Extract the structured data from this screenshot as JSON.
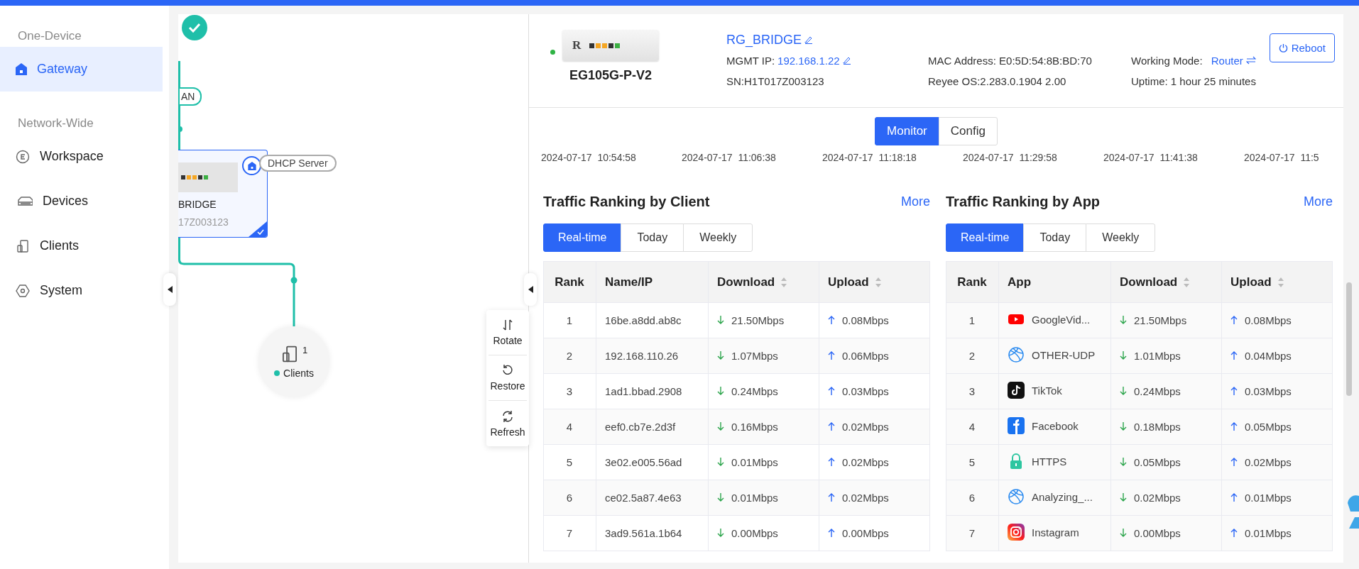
{
  "sidebar": {
    "sections": [
      {
        "title": "One-Device",
        "items": [
          {
            "label": "Gateway",
            "kind": "home",
            "selected": true
          }
        ]
      },
      {
        "title": "Network-Wide",
        "items": [
          {
            "label": "Workspace",
            "kind": "workspace",
            "selected": false
          },
          {
            "label": "Devices",
            "kind": "devices",
            "selected": false
          },
          {
            "label": "Clients",
            "kind": "clients",
            "selected": false
          },
          {
            "label": "System",
            "kind": "system",
            "selected": false
          }
        ]
      }
    ]
  },
  "topology": {
    "wan_label": "AN",
    "device": {
      "name": "BRIDGE",
      "serial": "17Z003123",
      "role": "DHCP Server",
      "selected": true
    },
    "clients": {
      "count": "1",
      "label": "Clients"
    },
    "tools": [
      {
        "label": "Rotate",
        "kind": "rotate"
      },
      {
        "label": "Restore",
        "kind": "restore"
      },
      {
        "label": "Refresh",
        "kind": "refresh"
      }
    ]
  },
  "device": {
    "online": true,
    "logo_letter": "R",
    "model": "EG105G-P-V2",
    "name": "RG_BRIDGE",
    "mgmt_ip_label": "MGMT IP:",
    "mgmt_ip": "192.168.1.22",
    "sn": "SN:H1T017Z003123",
    "mac": "MAC Address: E0:5D:54:8B:BD:70",
    "os": "Reyee OS:2.283.0.1904 2.00",
    "mode_label": "Working Mode:",
    "mode": "Router",
    "uptime": "Uptime: 1 hour 25 minutes",
    "reboot": "Reboot"
  },
  "view_tabs": [
    {
      "label": "Monitor",
      "selected": true
    },
    {
      "label": "Config",
      "selected": false
    }
  ],
  "timeline_labels": [
    "2024-07-17  10:54:58",
    "2024-07-17  11:06:38",
    "2024-07-17  11:18:18",
    "2024-07-17  11:29:58",
    "2024-07-17  11:41:38",
    "2024-07-17  11:5"
  ],
  "panels": [
    {
      "title": "Traffic Ranking by Client",
      "more": "More",
      "periods": [
        {
          "label": "Real-time",
          "selected": true
        },
        {
          "label": "Today",
          "selected": false
        },
        {
          "label": "Weekly",
          "selected": false
        }
      ],
      "columns": [
        "Rank",
        "Name/IP",
        "Download",
        "Upload"
      ],
      "rows": [
        {
          "rank": "1",
          "name": "16be.a8dd.ab8c",
          "download": "21.50Mbps",
          "upload": "0.08Mbps"
        },
        {
          "rank": "2",
          "name": "192.168.110.26",
          "download": "1.07Mbps",
          "upload": "0.06Mbps"
        },
        {
          "rank": "3",
          "name": "1ad1.bbad.2908",
          "download": "0.24Mbps",
          "upload": "0.03Mbps"
        },
        {
          "rank": "4",
          "name": "eef0.cb7e.2d3f",
          "download": "0.16Mbps",
          "upload": "0.02Mbps"
        },
        {
          "rank": "5",
          "name": "3e02.e005.56ad",
          "download": "0.01Mbps",
          "upload": "0.02Mbps"
        },
        {
          "rank": "6",
          "name": "ce02.5a87.4e63",
          "download": "0.01Mbps",
          "upload": "0.02Mbps"
        },
        {
          "rank": "7",
          "name": "3ad9.561a.1b64",
          "download": "0.00Mbps",
          "upload": "0.00Mbps"
        }
      ]
    },
    {
      "title": "Traffic Ranking by App",
      "more": "More",
      "periods": [
        {
          "label": "Real-time",
          "selected": true
        },
        {
          "label": "Today",
          "selected": false
        },
        {
          "label": "Weekly",
          "selected": false
        }
      ],
      "columns": [
        "Rank",
        "App",
        "Download",
        "Upload"
      ],
      "rows": [
        {
          "rank": "1",
          "kind": "video",
          "name": "GoogleVid...",
          "download": "21.50Mbps",
          "upload": "0.08Mbps"
        },
        {
          "rank": "2",
          "kind": "globe",
          "name": "OTHER-UDP",
          "download": "1.01Mbps",
          "upload": "0.04Mbps"
        },
        {
          "rank": "3",
          "kind": "note",
          "name": "TikTok",
          "download": "0.24Mbps",
          "upload": "0.03Mbps"
        },
        {
          "rank": "4",
          "kind": "social",
          "name": "Facebook",
          "download": "0.18Mbps",
          "upload": "0.05Mbps"
        },
        {
          "rank": "5",
          "kind": "lock",
          "name": "HTTPS",
          "download": "0.05Mbps",
          "upload": "0.02Mbps"
        },
        {
          "rank": "6",
          "kind": "globe",
          "name": "Analyzing_...",
          "download": "0.02Mbps",
          "upload": "0.01Mbps"
        },
        {
          "rank": "7",
          "kind": "camera",
          "name": "Instagram",
          "download": "0.00Mbps",
          "upload": "0.01Mbps"
        }
      ]
    }
  ]
}
